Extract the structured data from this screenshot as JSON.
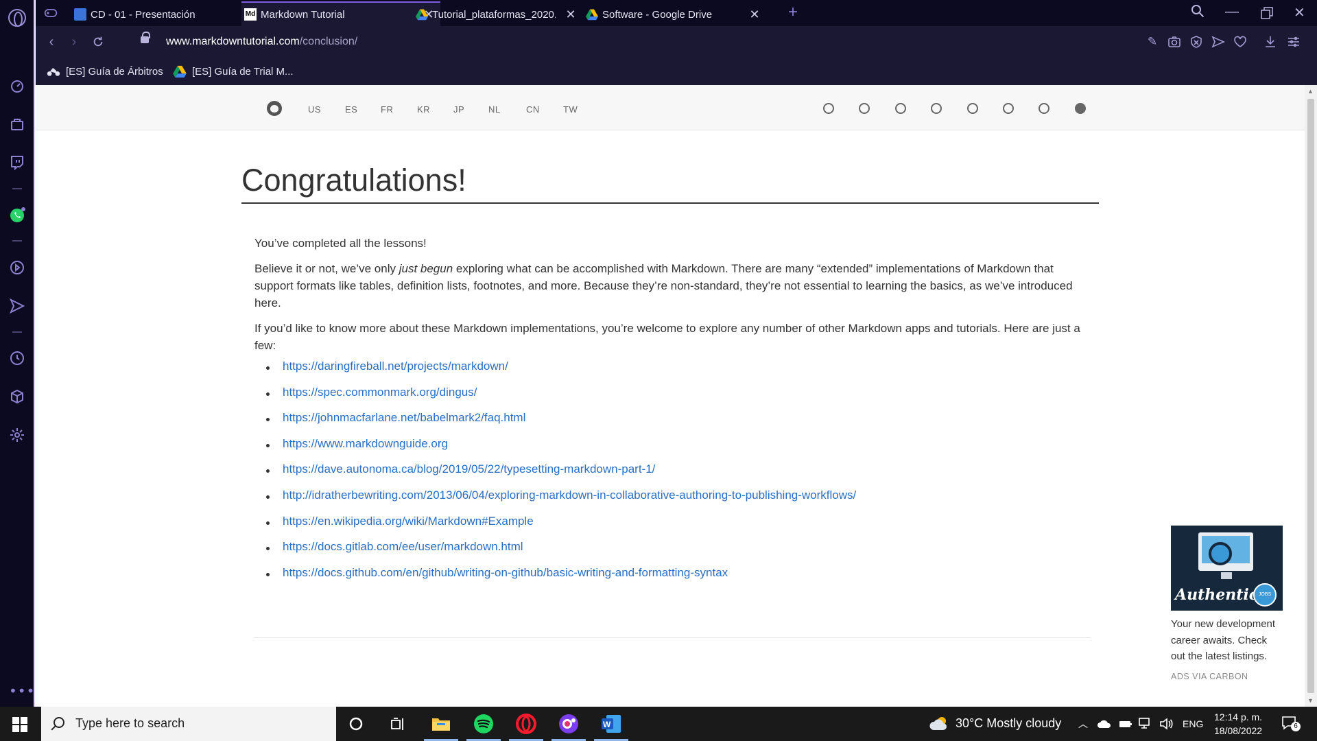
{
  "browser": {
    "tabs": [
      {
        "title": "",
        "icon": "gamepad-icon"
      },
      {
        "title": "CD - 01 - Presentación",
        "icon": "classroom-icon"
      },
      {
        "title": "Markdown Tutorial",
        "icon": "md-icon",
        "active": true
      },
      {
        "title": "Tutorial_plataformas_2020...",
        "icon": "google-drive-icon"
      },
      {
        "title": "Software - Google Drive",
        "icon": "google-drive-icon"
      }
    ],
    "url_host": "www.markdowntutorial.com",
    "url_path": "/conclusion/",
    "bookmarks": [
      "[ES] Guía de Árbitros",
      "[ES] Guía de Trial M..."
    ],
    "accent": "#6d28d9"
  },
  "site": {
    "languages": [
      "US",
      "ES",
      "FR",
      "KR",
      "JP",
      "NL",
      "CN",
      "TW"
    ],
    "lessons": [
      false,
      false,
      false,
      false,
      false,
      false,
      false,
      true
    ]
  },
  "article": {
    "title": "Congratulations!",
    "p1": "You’ve completed all the lessons!",
    "p2_pre": "Believe it or not, we’ve only ",
    "p2_em": "just begun",
    "p2_post": " exploring what can be accomplished with Markdown. There are many “extended” implementations of Markdown that support formats like tables, definition lists, footnotes, and more. Because they’re non-standard, they’re not essential to learning the basics, as we’ve introduced here.",
    "p3": "If you’d like to know more about these Markdown implementations, you’re welcome to explore any number of other Markdown apps and tutorials. Here are just a few:",
    "links": [
      "https://daringfireball.net/projects/markdown/",
      "https://spec.commonmark.org/dingus/",
      "https://johnmacfarlane.net/babelmark2/faq.html",
      "https://www.markdownguide.org",
      "https://dave.autonoma.ca/blog/2019/05/22/typesetting-markdown-part-1/",
      "http://idratherbewriting.com/2013/06/04/exploring-markdown-in-collaborative-authoring-to-publishing-workflows/",
      "https://en.wikipedia.org/wiki/Markdown#Example",
      "https://docs.gitlab.com/ee/user/markdown.html",
      "https://docs.github.com/en/github/writing-on-github/basic-writing-and-formatting-syntax"
    ],
    "link_color": "#2a6ec3"
  },
  "ad": {
    "brand": "Authentic",
    "badge": "JOBS",
    "text": "Your new development career awaits. Check out the latest listings.",
    "via": "ADS VIA CARBON"
  },
  "taskbar": {
    "search_placeholder": "Type here to search",
    "weather": "30°C  Mostly cloudy",
    "language": "ENG",
    "time": "12:14 p. m.",
    "date": "18/08/2022",
    "notifications": "6"
  }
}
